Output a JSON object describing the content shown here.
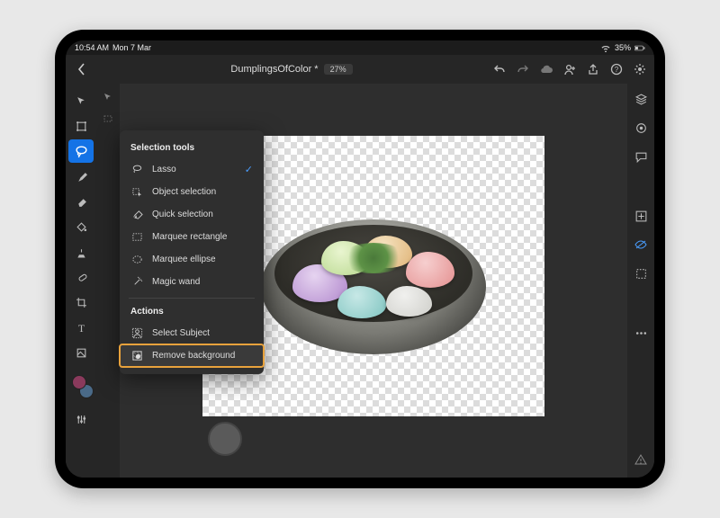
{
  "status": {
    "time": "10:54 AM",
    "date": "Mon 7 Mar",
    "battery": "35%"
  },
  "doc": {
    "name": "DumplingsOfColor *",
    "zoom": "27%"
  },
  "popover": {
    "tools_header": "Selection tools",
    "actions_header": "Actions",
    "lasso": "Lasso",
    "object_selection": "Object selection",
    "quick_selection": "Quick selection",
    "marquee_rect": "Marquee rectangle",
    "marquee_ellipse": "Marquee ellipse",
    "magic_wand": "Magic wand",
    "select_subject": "Select Subject",
    "remove_bg": "Remove background"
  }
}
